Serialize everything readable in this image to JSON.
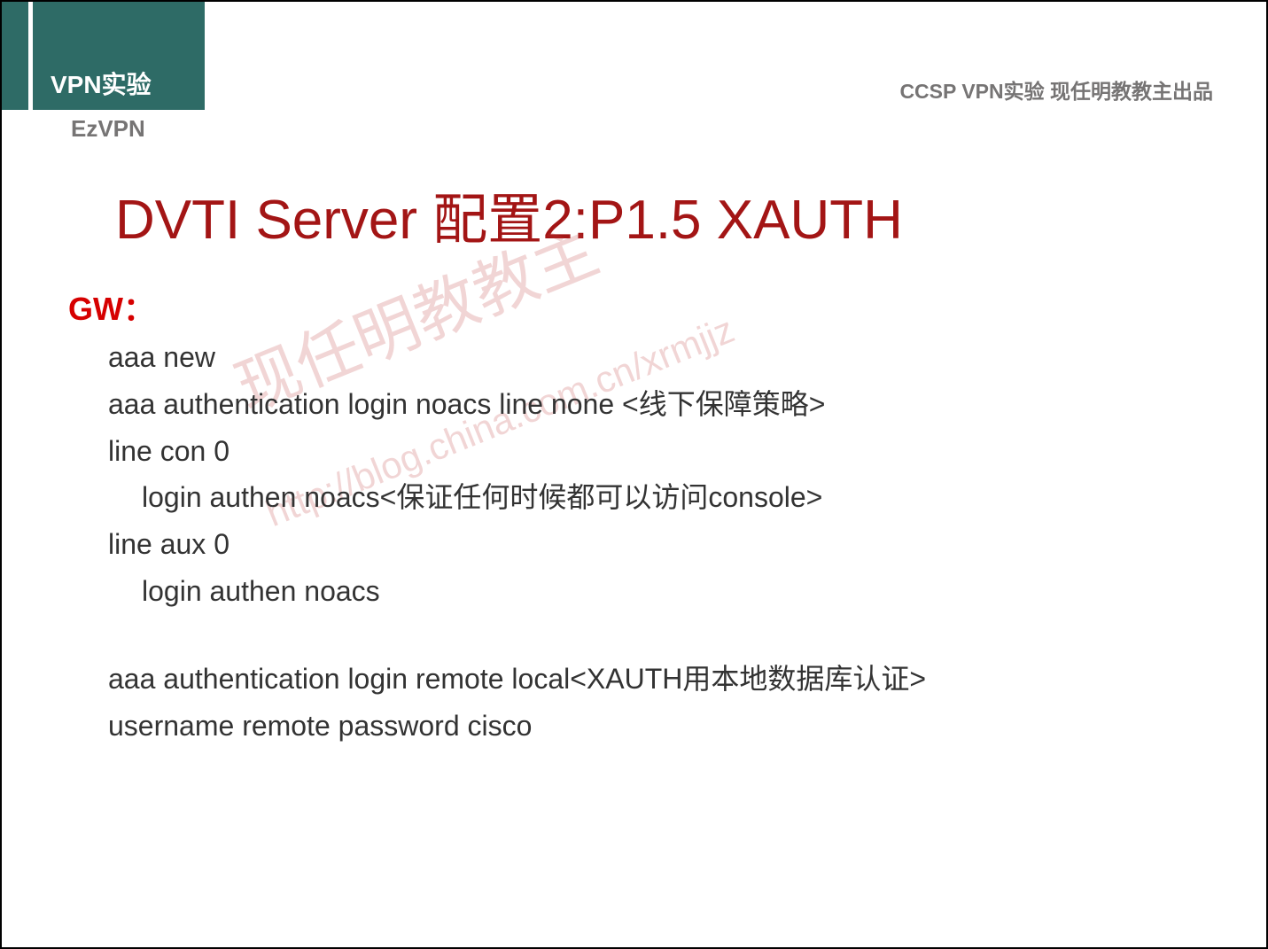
{
  "header": {
    "title": "VPN实验",
    "sub": "EzVPN",
    "top_right": "CCSP VPN实验 现任明教教主出品"
  },
  "main_title": "DVTI Server 配置2:P1.5 XAUTH",
  "gw_label": "GW：",
  "code": {
    "line1": "aaa new",
    "line2": "aaa authentication login noacs line none <线下保障策略>",
    "line3": "line con 0",
    "line4": "login authen noacs<保证任何时候都可以访问console>",
    "line5": "line aux 0",
    "line6": "login authen noacs",
    "line7": "aaa authentication login remote local<XAUTH用本地数据库认证>",
    "line8": "username remote password cisco"
  },
  "watermark": {
    "text1": "现任明教教主",
    "text2": "http://blog.china.com.cn/xrmjjz"
  }
}
